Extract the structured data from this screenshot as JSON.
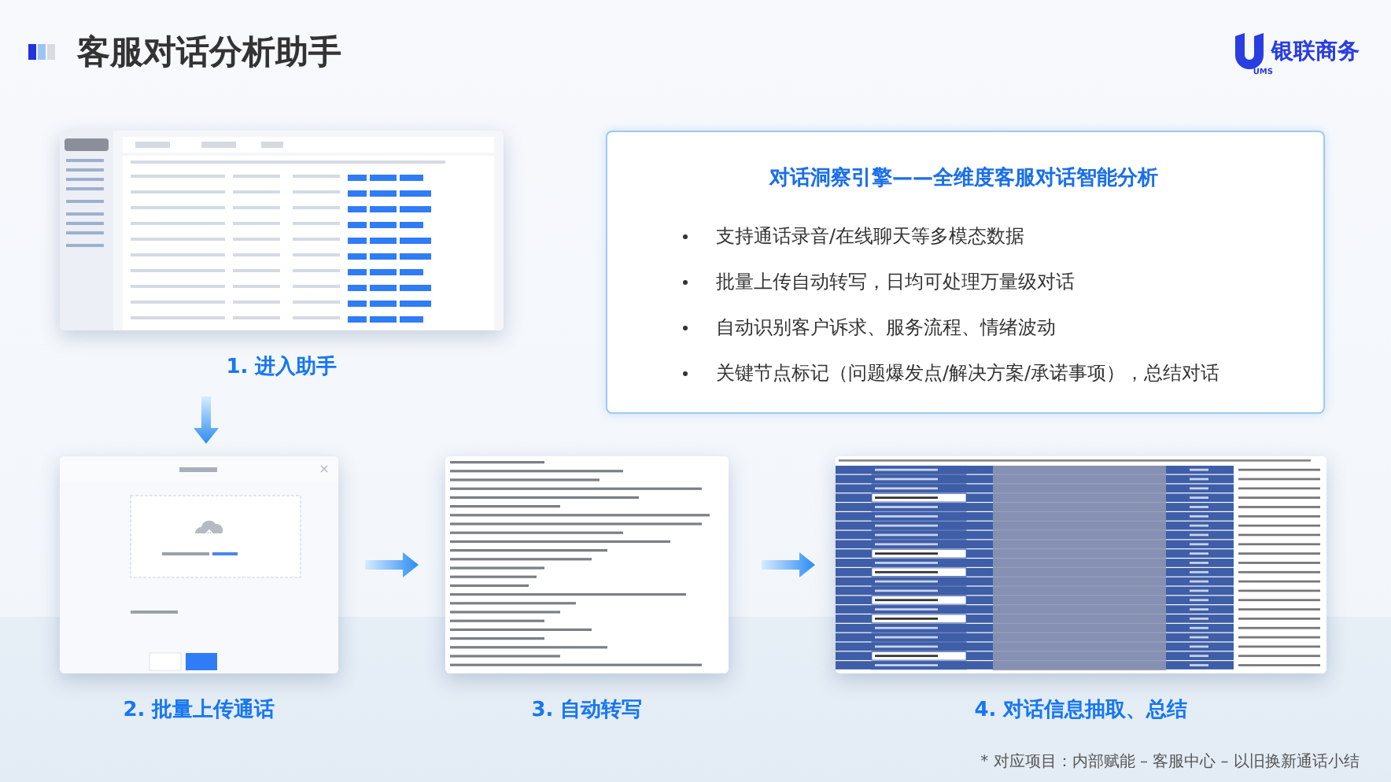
{
  "header": {
    "title": "客服对话分析助手",
    "logo_text": "银联商务",
    "logo_subtext": "UMS"
  },
  "feature_card": {
    "title": "对话洞察引擎——全维度客服对话智能分析",
    "bullets": [
      "支持通话录音/在线聊天等多模态数据",
      "批量上传自动转写，日均可处理万量级对话",
      "自动识别客户诉求、服务流程、情绪波动",
      "关键节点标记（问题爆发点/解决方案/承诺事项），总结对话"
    ]
  },
  "steps": [
    {
      "kind": "table",
      "label": "1. 进入助手"
    },
    {
      "kind": "upload",
      "label": "2. 批量上传通话"
    },
    {
      "kind": "transcript",
      "label": "3. 自动转写"
    },
    {
      "kind": "spreadsheet",
      "label": "4. 对话信息抽取、总结"
    }
  ],
  "footnote": "* 对应项目：内部赋能 – 客服中心 – 以旧换新通话小结"
}
